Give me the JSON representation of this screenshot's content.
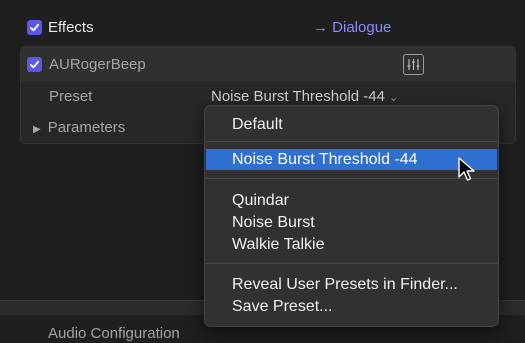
{
  "header": {
    "effects_label": "Effects",
    "dialogue_label": "→ Dialogue"
  },
  "effect": {
    "name": "AURogerBeep",
    "preset_label": "Preset",
    "preset_value": "Noise Burst Threshold -44",
    "parameters_label": "Parameters"
  },
  "footer": {
    "audio_configuration": "Audio Configuration"
  },
  "preset_menu": {
    "items": [
      "Default",
      "Noise Burst Threshold -44",
      "Quindar",
      "Noise Burst",
      "Walkie Talkie",
      "Reveal User Presets in Finder...",
      "Save Preset..."
    ],
    "selected": "Noise Burst Threshold -44"
  },
  "colors": {
    "accent": "#5d57e8",
    "selection": "#2f6fd0",
    "dialogue": "#8d89ff"
  }
}
